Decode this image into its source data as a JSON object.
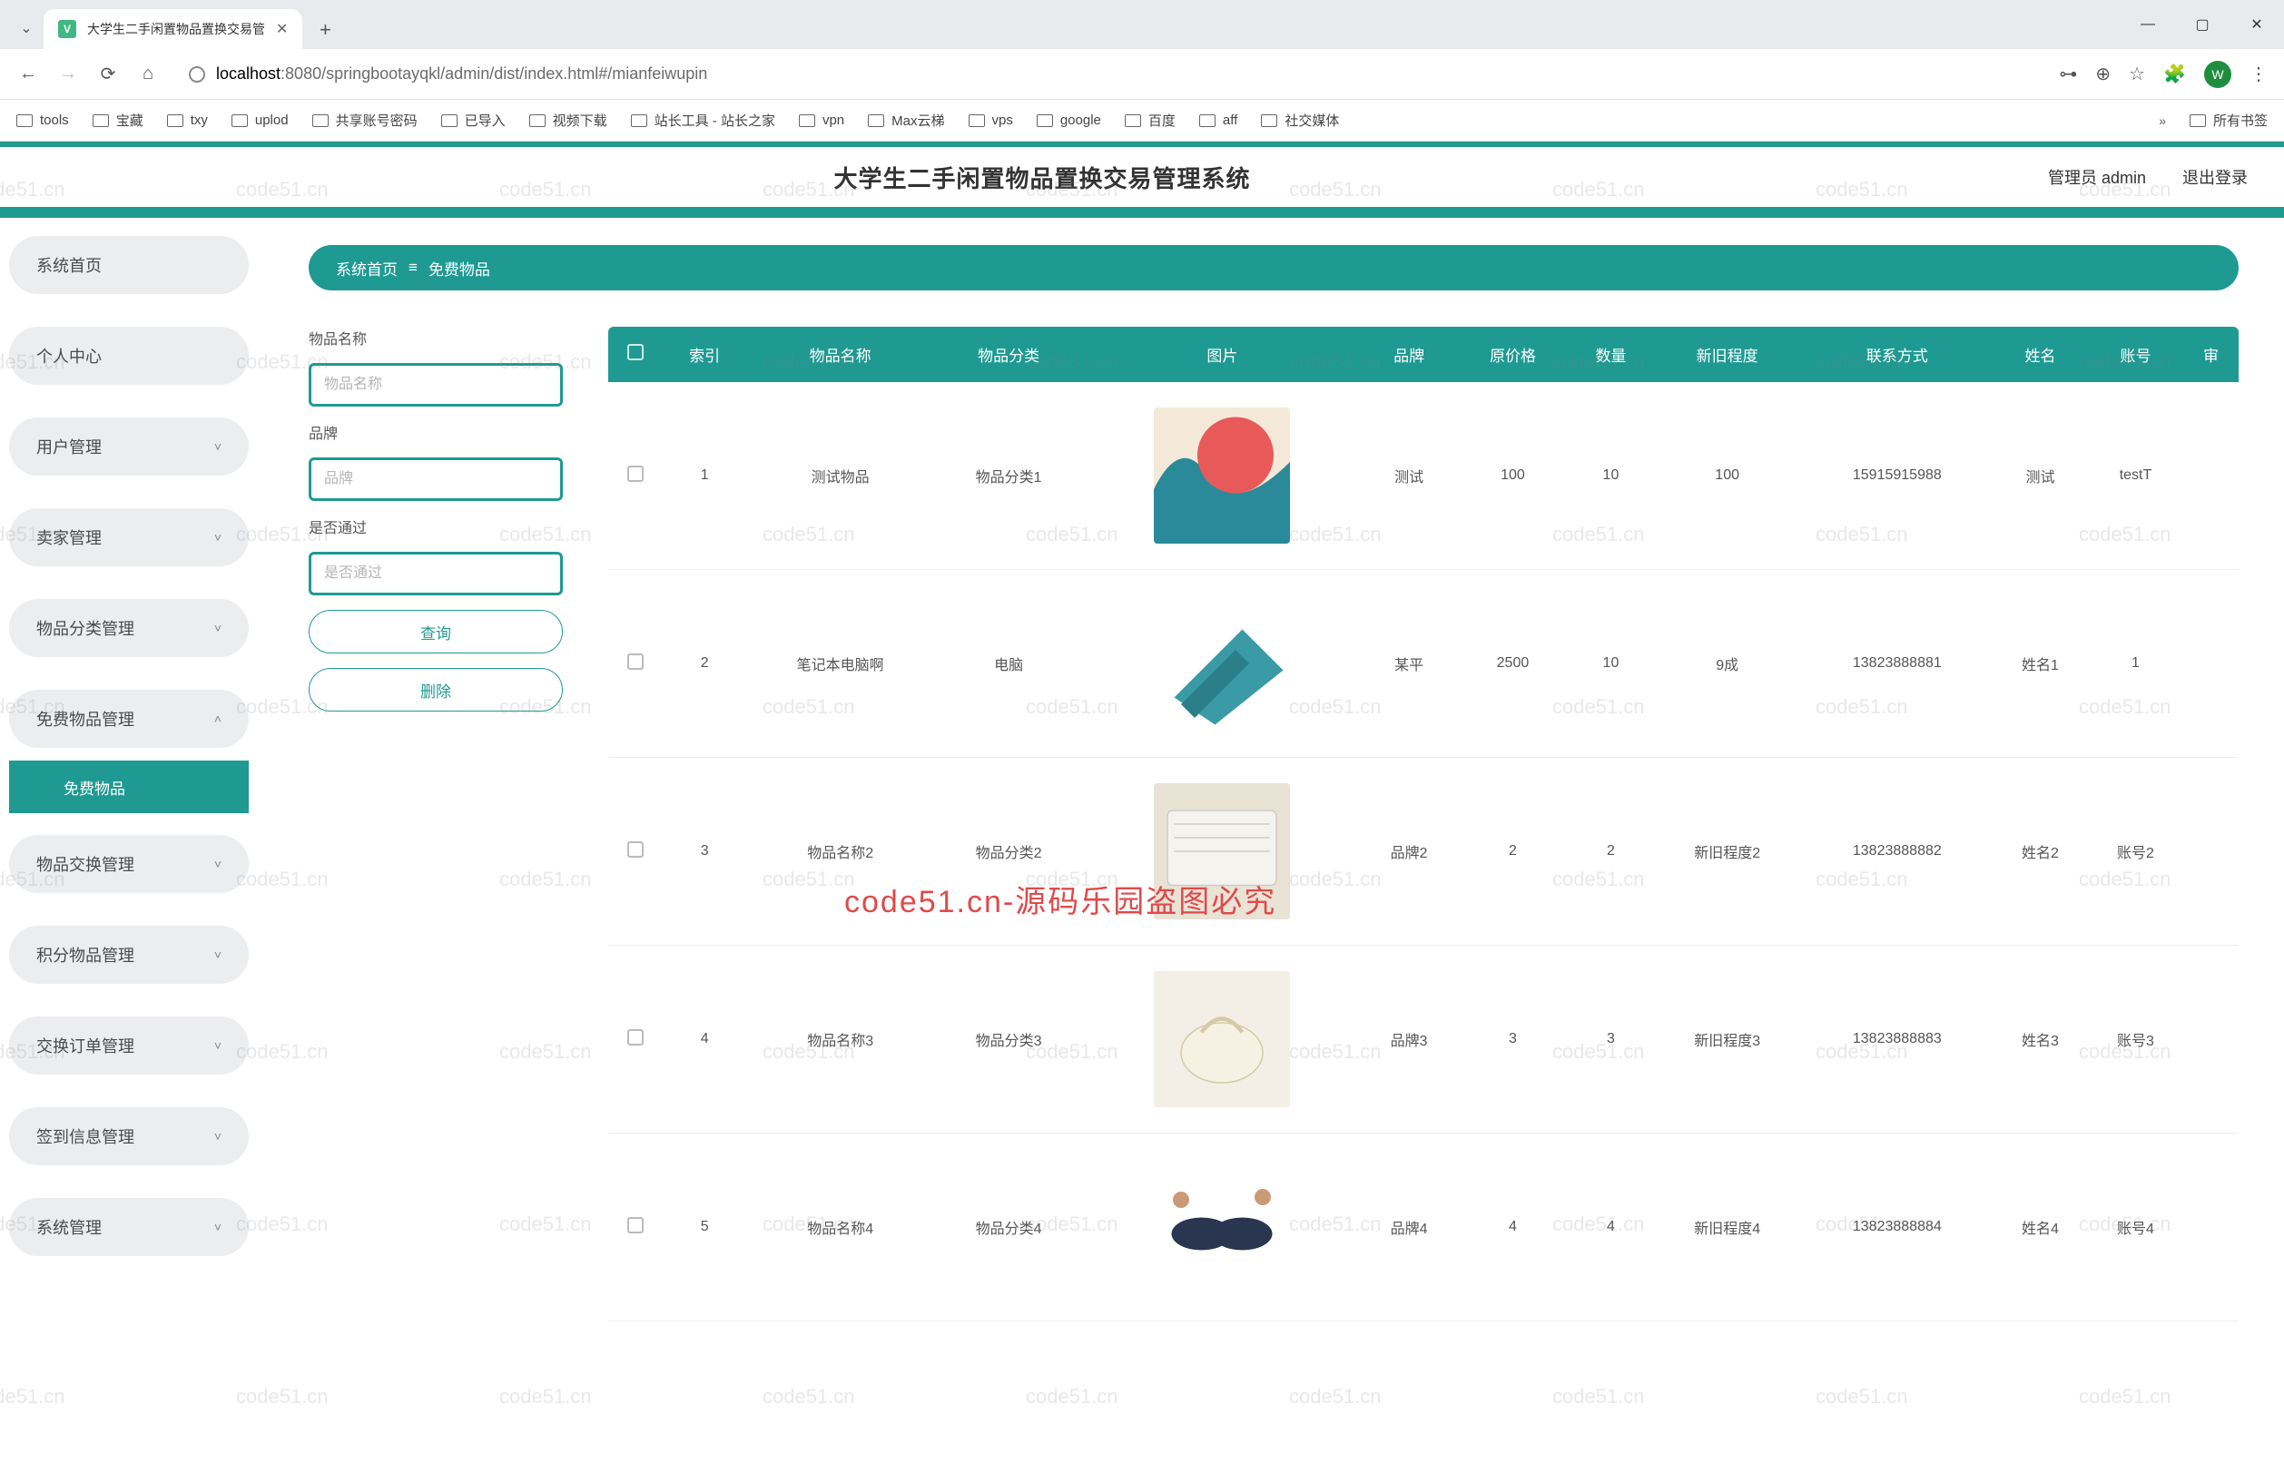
{
  "browser": {
    "tab_title": "大学生二手闲置物品置换交易管",
    "url_host": "localhost",
    "url_port": ":8080",
    "url_path": "/springbootayqkl/admin/dist/index.html#/mianfeiwupin",
    "avatar_letter": "W",
    "bookmarks": [
      "tools",
      "宝藏",
      "txy",
      "uplod",
      "共享账号密码",
      "已导入",
      "视频下载",
      "站长工具 - 站长之家",
      "vpn",
      "Max云梯",
      "vps",
      "google",
      "百度",
      "aff",
      "社交媒体"
    ],
    "all_bookmarks_label": "所有书签"
  },
  "header": {
    "title": "大学生二手闲置物品置换交易管理系统",
    "admin_label": "管理员 admin",
    "logout_label": "退出登录"
  },
  "sidebar": {
    "items": [
      {
        "label": "系统首页",
        "hasSub": false
      },
      {
        "label": "个人中心",
        "hasSub": false
      },
      {
        "label": "用户管理",
        "hasSub": true
      },
      {
        "label": "卖家管理",
        "hasSub": true
      },
      {
        "label": "物品分类管理",
        "hasSub": true
      },
      {
        "label": "免费物品管理",
        "hasSub": true,
        "expanded": true,
        "sub": [
          {
            "label": "免费物品",
            "active": true
          }
        ]
      },
      {
        "label": "物品交换管理",
        "hasSub": true
      },
      {
        "label": "积分物品管理",
        "hasSub": true
      },
      {
        "label": "交换订单管理",
        "hasSub": true
      },
      {
        "label": "签到信息管理",
        "hasSub": true
      },
      {
        "label": "系统管理",
        "hasSub": true
      }
    ]
  },
  "breadcrumb": {
    "home": "系统首页",
    "sep": "≡",
    "current": "免费物品"
  },
  "search": {
    "name_label": "物品名称",
    "name_placeholder": "物品名称",
    "brand_label": "品牌",
    "brand_placeholder": "品牌",
    "approve_label": "是否通过",
    "approve_placeholder": "是否通过",
    "query_btn": "查询",
    "delete_btn": "删除"
  },
  "table": {
    "columns": [
      "",
      "索引",
      "物品名称",
      "物品分类",
      "图片",
      "品牌",
      "原价格",
      "数量",
      "新旧程度",
      "联系方式",
      "姓名",
      "账号",
      "审"
    ],
    "rows": [
      {
        "idx": "1",
        "name": "测试物品",
        "cat": "物品分类1",
        "brand": "测试",
        "price": "100",
        "qty": "10",
        "cond": "100",
        "tel": "15915915988",
        "uname": "测试",
        "acct": "testT"
      },
      {
        "idx": "2",
        "name": "笔记本电脑啊",
        "cat": "电脑",
        "brand": "某平",
        "price": "2500",
        "qty": "10",
        "cond": "9成",
        "tel": "13823888881",
        "uname": "姓名1",
        "acct": "1"
      },
      {
        "idx": "3",
        "name": "物品名称2",
        "cat": "物品分类2",
        "brand": "品牌2",
        "price": "2",
        "qty": "2",
        "cond": "新旧程度2",
        "tel": "13823888882",
        "uname": "姓名2",
        "acct": "账号2"
      },
      {
        "idx": "4",
        "name": "物品名称3",
        "cat": "物品分类3",
        "brand": "品牌3",
        "price": "3",
        "qty": "3",
        "cond": "新旧程度3",
        "tel": "13823888883",
        "uname": "姓名3",
        "acct": "账号3"
      },
      {
        "idx": "5",
        "name": "物品名称4",
        "cat": "物品分类4",
        "brand": "品牌4",
        "price": "4",
        "qty": "4",
        "cond": "新旧程度4",
        "tel": "13823888884",
        "uname": "姓名4",
        "acct": "账号4"
      }
    ]
  },
  "watermark": {
    "text": "code51.cn",
    "red": "code51.cn-源码乐园盗图必究"
  }
}
